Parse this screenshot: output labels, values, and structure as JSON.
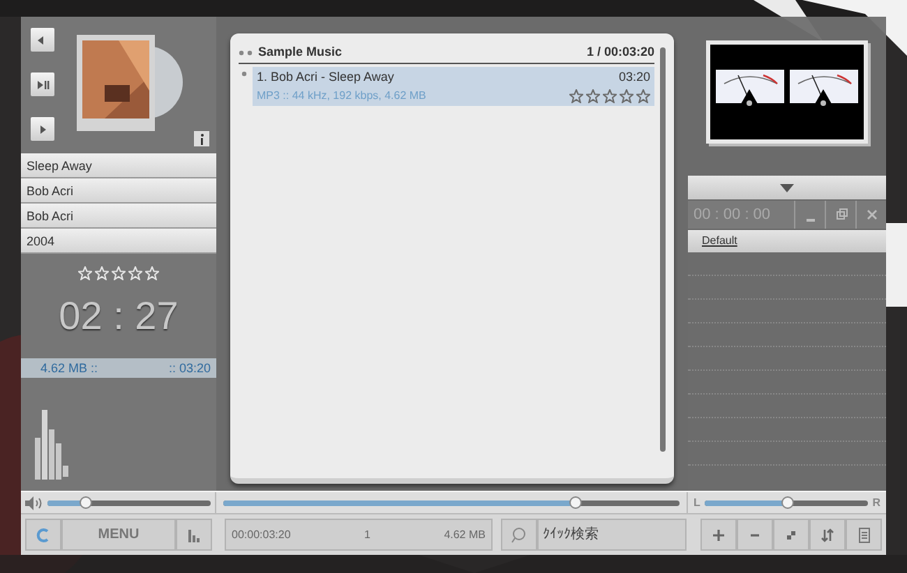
{
  "track_info": {
    "fields": [
      "Sleep Away",
      "Bob Acri",
      "Bob Acri",
      "2004"
    ],
    "stars": 0,
    "time": "02 : 27",
    "size": "4.62 MB ::",
    "duration": ":: 03:20"
  },
  "playlist": {
    "title": "Sample Music",
    "summary": "1 / 00:03:20",
    "tracks": [
      {
        "title": "1. Bob Acri - Sleep Away",
        "duration": "03:20",
        "details": "MP3 :: 44 kHz, 192 kbps, 4.62 MB",
        "stars": 0,
        "selected": true
      }
    ]
  },
  "volume": {
    "level": 0.23
  },
  "seek": {
    "level": 0.77
  },
  "balance": {
    "level": 0.5,
    "left_label": "L",
    "right_label": "R"
  },
  "menu_button": "MENU",
  "status": {
    "elapsed": "00:00:03:20",
    "count": "1",
    "size": "4.62 MB"
  },
  "search": {
    "placeholder": "ｸｲｯｸ検索"
  },
  "right_panel": {
    "timer": "00 : 00 : 00",
    "preset": "Default"
  }
}
